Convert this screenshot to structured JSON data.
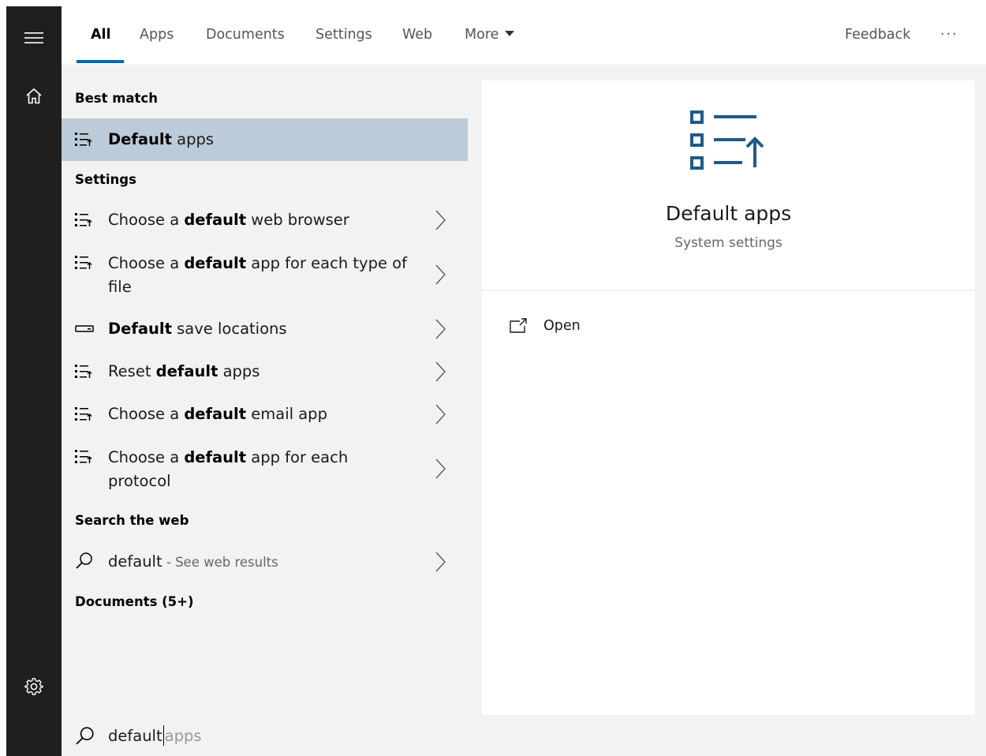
{
  "tabs": [
    {
      "label": "All",
      "active": true
    },
    {
      "label": "Apps"
    },
    {
      "label": "Documents"
    },
    {
      "label": "Settings"
    },
    {
      "label": "Web"
    },
    {
      "label": "More"
    }
  ],
  "topbar": {
    "feedback": "Feedback",
    "overflow": "···"
  },
  "rail": {
    "icons": [
      "menu-icon",
      "home-icon",
      "gear-icon"
    ]
  },
  "sections": {
    "best_match": "Best match",
    "settings": "Settings",
    "search_web": "Search the web",
    "documents": "Documents (5+)"
  },
  "best_match": {
    "label_bold": "Default",
    "label_rest": " apps",
    "icon": "list-settings-icon"
  },
  "settings_items": [
    {
      "pre": "Choose a ",
      "bold": "default",
      "post": " web browser",
      "icon": "list-settings-icon"
    },
    {
      "pre": "Choose a ",
      "bold": "default",
      "post": " app for each type of file",
      "icon": "list-settings-icon"
    },
    {
      "pre": "",
      "bold": "Default",
      "post": " save locations",
      "icon": "drive-icon"
    },
    {
      "pre": "Reset ",
      "bold": "default",
      "post": " apps",
      "icon": "list-settings-icon"
    },
    {
      "pre": "Choose a ",
      "bold": "default",
      "post": " email app",
      "icon": "list-settings-icon"
    },
    {
      "pre": "Choose a ",
      "bold": "default",
      "post": " app for each protocol",
      "icon": "list-settings-icon"
    }
  ],
  "web_result": {
    "query": "default",
    "suffix": " - See web results"
  },
  "search": {
    "typed": "default",
    "suggestion": "apps"
  },
  "preview": {
    "title": "Default apps",
    "subtitle": "System settings",
    "actions": [
      {
        "label": "Open",
        "icon": "open-external-icon"
      }
    ],
    "icon": "default-apps-large-icon"
  },
  "colors": {
    "rail": "#1f1f1f",
    "accent": "#0067b8",
    "selected": "#bccbd8",
    "pane": "#f2f2f2",
    "preview_icon": "#1e5a8a"
  }
}
